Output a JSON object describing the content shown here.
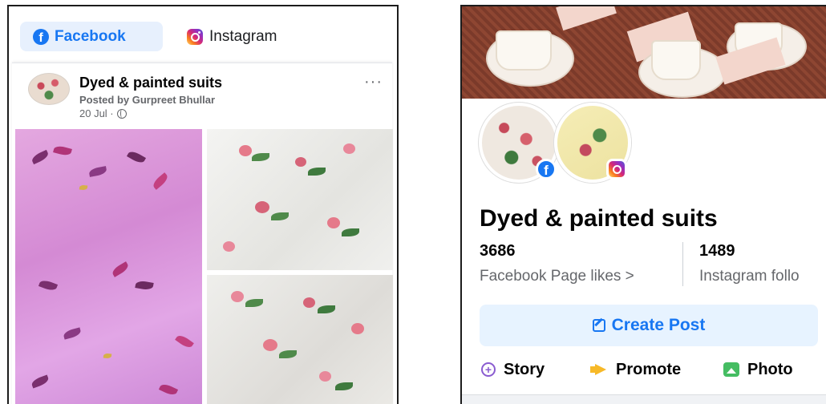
{
  "left_panel": {
    "tabs": [
      {
        "label": "Facebook",
        "icon": "facebook-icon",
        "active": true
      },
      {
        "label": "Instagram",
        "icon": "instagram-icon",
        "active": false
      }
    ],
    "post": {
      "title": "Dyed & painted suits",
      "author": "Posted by Gurpreet Bhullar",
      "date": "20 Jul ·",
      "more_icon": "more-options-icon",
      "more_label": "···"
    }
  },
  "right_panel": {
    "page_name": "Dyed & painted suits",
    "stats": [
      {
        "value": "3686",
        "label": "Facebook Page likes >"
      },
      {
        "value": "1489",
        "label": "Instagram follo"
      }
    ],
    "create_post_label": "Create Post",
    "actions": [
      {
        "label": "Story",
        "icon": "story-icon"
      },
      {
        "label": "Promote",
        "icon": "megaphone-icon"
      },
      {
        "label": "Photo",
        "icon": "photo-icon"
      }
    ]
  },
  "colors": {
    "facebook_blue": "#1877f2",
    "tab_active_bg": "#e7f0fd",
    "secondary_text": "#65676b",
    "primary_text": "#050505"
  }
}
